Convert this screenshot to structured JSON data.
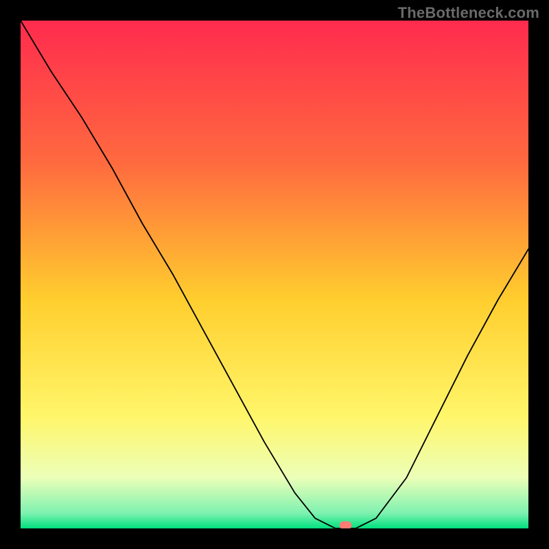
{
  "watermark": "TheBottleneck.com",
  "colors": {
    "frame": "#000000",
    "curve": "#000000",
    "marker": "#ff7b74",
    "gradient_stops": [
      {
        "offset": 0,
        "color": "#ff2b4e"
      },
      {
        "offset": 28,
        "color": "#ff6a3f"
      },
      {
        "offset": 55,
        "color": "#ffce2e"
      },
      {
        "offset": 78,
        "color": "#fff66a"
      },
      {
        "offset": 90,
        "color": "#ecffb8"
      },
      {
        "offset": 97,
        "color": "#7ef2b0"
      },
      {
        "offset": 100,
        "color": "#00e07e"
      }
    ]
  },
  "chart_data": {
    "type": "line",
    "title": "",
    "xlabel": "",
    "ylabel": "",
    "xlim": [
      0,
      100
    ],
    "ylim": [
      0,
      100
    ],
    "x": [
      0,
      6,
      12,
      18,
      24,
      30,
      36,
      42,
      48,
      54,
      58,
      62,
      66,
      70,
      76,
      82,
      88,
      94,
      100
    ],
    "values": [
      100,
      90,
      81,
      71,
      60,
      50,
      39,
      28,
      17,
      7,
      2,
      0,
      0,
      2,
      10,
      22,
      34,
      45,
      55
    ],
    "marker": {
      "x": 64,
      "y": 0
    }
  }
}
